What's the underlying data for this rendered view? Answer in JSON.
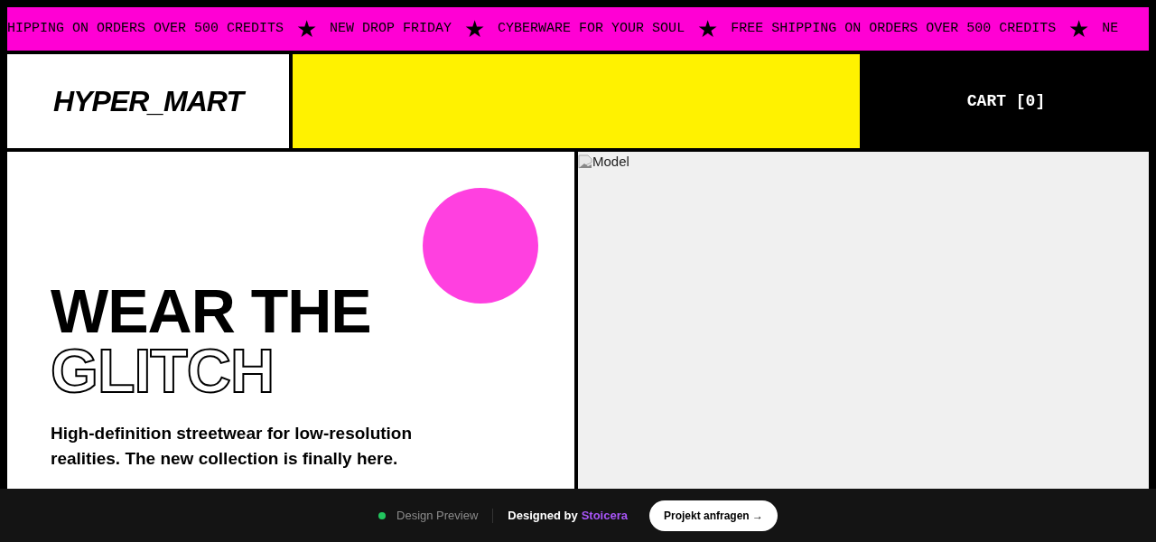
{
  "ticker": {
    "items": [
      {
        "kind": "text",
        "text": "HIPPING ON ORDERS OVER 500 CREDITS"
      },
      {
        "kind": "separator",
        "text": "★"
      },
      {
        "kind": "text",
        "text": "NEW DROP FRIDAY"
      },
      {
        "kind": "separator",
        "text": "★"
      },
      {
        "kind": "text",
        "text": "CYBERWARE FOR YOUR SOUL"
      },
      {
        "kind": "separator",
        "text": "★"
      },
      {
        "kind": "text",
        "text": "FREE SHIPPING ON ORDERS OVER 500 CREDITS"
      },
      {
        "kind": "separator",
        "text": "★"
      },
      {
        "kind": "text",
        "text": "NE"
      }
    ]
  },
  "header": {
    "logo": "HYPER_MART",
    "cart": "CART [0]"
  },
  "hero": {
    "title_solid": "WEAR THE",
    "title_outline": "GLITCH",
    "description": "High-definition streetwear for low-resolution realities. The new collection is finally here.",
    "image_alt": "Model"
  },
  "preview_bar": {
    "status": "Design Preview",
    "credit": "Designed by",
    "credit_link": "Stoicera",
    "button": "Projekt anfragen →"
  }
}
